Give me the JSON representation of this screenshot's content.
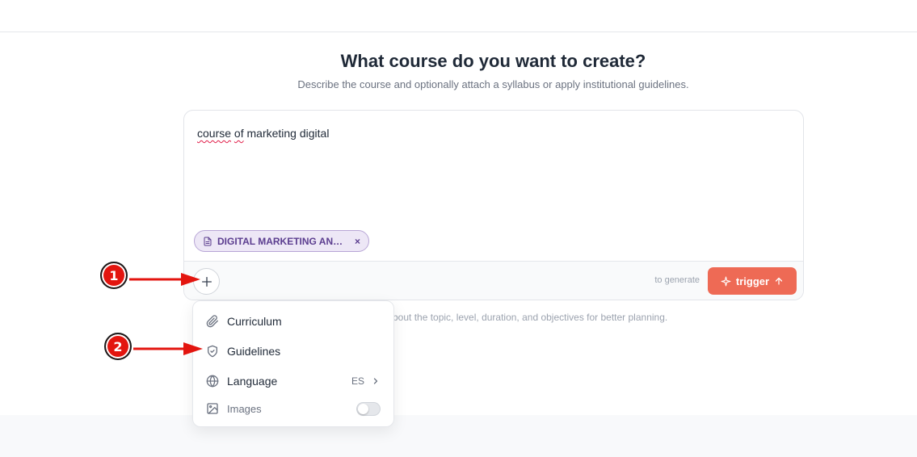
{
  "header": {
    "title": "What course do you want to create?",
    "subtitle": "Describe the course and optionally attach a syllabus or apply institutional guidelines."
  },
  "composer": {
    "prompt_word1": "course",
    "prompt_word2": "of",
    "prompt_rest": "marketing digital",
    "attachment_label": "DIGITAL MARKETING AN…",
    "attachment_remove": "×",
    "hint": "to generate",
    "trigger_label": "trigger"
  },
  "helper_text": "bout the topic, level, duration, and objectives for better planning.",
  "menu": {
    "items": [
      {
        "label": "Curriculum",
        "icon": "paperclip-icon"
      },
      {
        "label": "Guidelines",
        "icon": "shield-check-icon"
      },
      {
        "label": "Language",
        "icon": "globe-icon",
        "value": "ES"
      },
      {
        "label": "Images",
        "icon": "image-icon",
        "toggle": false
      }
    ]
  },
  "annotations": {
    "badge1": "1",
    "badge2": "2"
  },
  "colors": {
    "accent": "#ee6a55",
    "chip_bg": "#ede7f6",
    "chip_text": "#5b3d8f",
    "annotation_red": "#e3150f"
  }
}
